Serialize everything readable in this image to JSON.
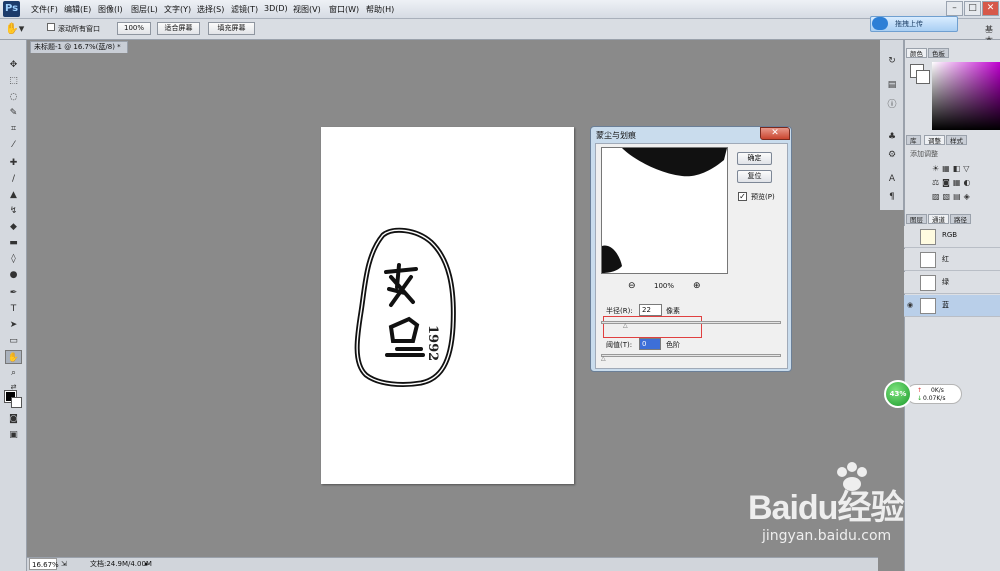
{
  "menubar": {
    "logo": "Ps",
    "items": [
      "文件(F)",
      "编辑(E)",
      "图像(I)",
      "图层(L)",
      "文字(Y)",
      "选择(S)",
      "滤镜(T)",
      "3D(D)",
      "视图(V)",
      "窗口(W)",
      "帮助(H)"
    ],
    "upload_button": "拖拽上传"
  },
  "options": {
    "scroll_all_windows": "滚动所有窗口",
    "zoom_value": "100%",
    "fit_screen": "适合屏幕",
    "fill_screen": "填充屏幕",
    "workspace": "基本"
  },
  "document": {
    "tab_title": "未标题-1 @ 16.7%(蓝/8) *",
    "zoom": "16.67%",
    "doc_info": "文档:24.9M/4.00M"
  },
  "dialog": {
    "title": "蒙尘与划痕",
    "ok": "确定",
    "reset": "复位",
    "preview_label": "预览(P)",
    "preview_checked": true,
    "zoom_level": "100%",
    "radius_label": "半径(R):",
    "radius_value": "22",
    "radius_unit": "像素",
    "threshold_label": "阈值(T):",
    "threshold_value": "0",
    "threshold_unit": "色阶"
  },
  "panels": {
    "color_tabs": [
      "颜色",
      "色板"
    ],
    "adjust_tabs": [
      "库",
      "调整",
      "样式"
    ],
    "add_adjustment": "添加调整",
    "layer_tabs": [
      "图层",
      "通道",
      "路径"
    ],
    "channels": [
      {
        "name": "RGB",
        "visible": false,
        "selected": false
      },
      {
        "name": "红",
        "visible": false,
        "selected": false
      },
      {
        "name": "绿",
        "visible": false,
        "selected": false
      },
      {
        "name": "蓝",
        "visible": true,
        "selected": true
      }
    ]
  },
  "net_widget": {
    "percent": "43%",
    "up": "0K/s",
    "down": "0.07K/s"
  },
  "watermark": {
    "brand": "Baidu经验",
    "url": "jingyan.baidu.com"
  },
  "colors": {
    "accent": "#1c3b6b",
    "highlight_box": "#e04040",
    "selected_row": "#b9cfe9"
  }
}
